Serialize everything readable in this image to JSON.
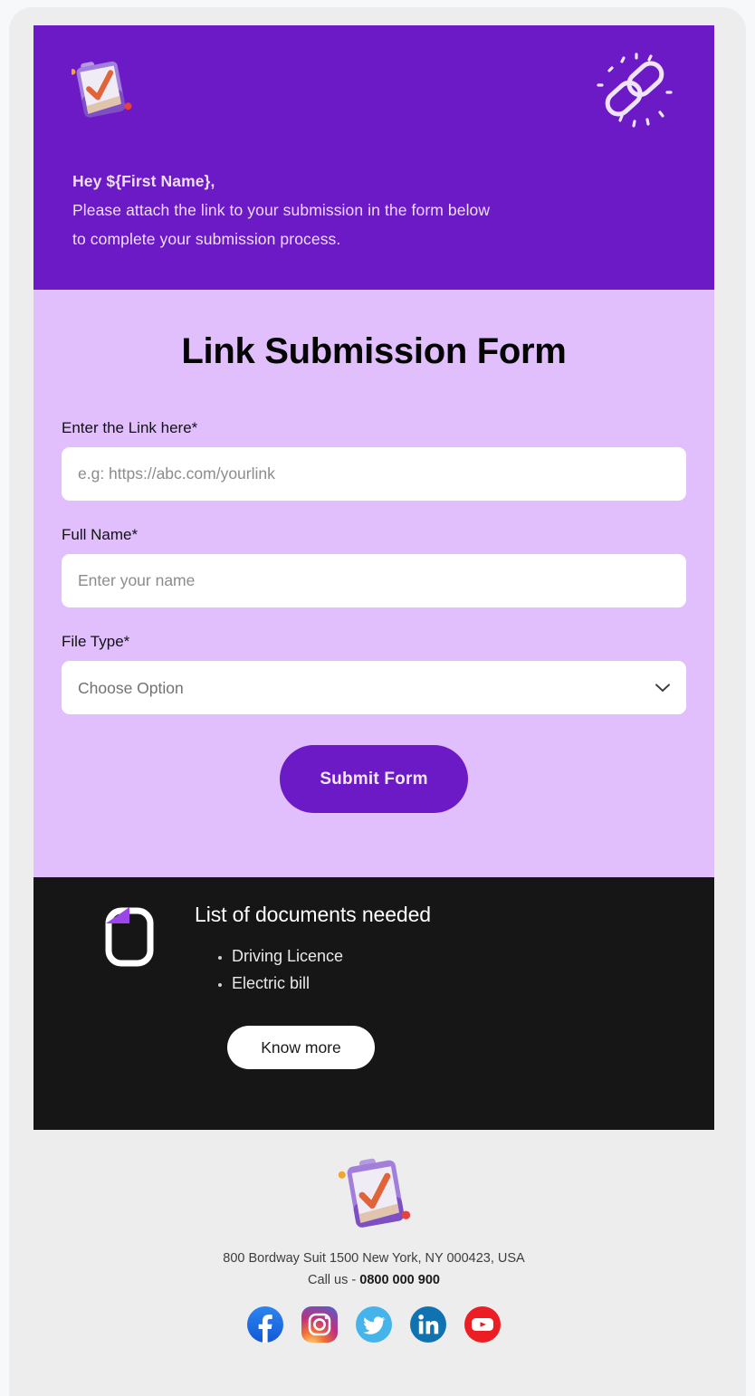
{
  "hero": {
    "clipboard_icon": "clipboard-check-3d-icon",
    "chain_icon": "chain-link-icon",
    "greeting": "Hey ${First Name},",
    "line_1": "Please attach the link to your submission in the form below",
    "line_2": "to complete your submission process.",
    "background_color": "#6C19C6",
    "text_color": "#EDDFF7"
  },
  "form": {
    "title": "Link Submission Form",
    "background_color": "#E0BFFC",
    "link_field": {
      "label": "Enter the Link here*",
      "placeholder": "e.g: https://abc.com/yourlink",
      "value": ""
    },
    "name_field": {
      "label": "Full Name*",
      "placeholder": "Enter your name",
      "value": ""
    },
    "filetype_field": {
      "label": "File Type*",
      "selected": "Choose Option",
      "chevron_icon": "chevron-down-icon"
    },
    "submit_label": "Submit Form",
    "submit_color": "#6C19C6"
  },
  "documents": {
    "background_color": "#161616",
    "file_icon": "document-file-icon",
    "heading": "List of documents needed",
    "items": [
      "Driving Licence",
      "Electric bill"
    ],
    "know_more_label": "Know more"
  },
  "footer": {
    "clipboard_icon": "clipboard-check-3d-icon",
    "address": "800 Bordway Suit 1500 New York, NY 000423, USA",
    "call_us_prefix": "Call us - ",
    "phone": "0800 000 900",
    "social": [
      {
        "name": "facebook-icon",
        "color": "#1877F2"
      },
      {
        "name": "instagram-icon",
        "color": "#E1306C"
      },
      {
        "name": "twitter-icon",
        "color": "#1DA1F2"
      },
      {
        "name": "linkedin-icon",
        "color": "#0A66C2"
      },
      {
        "name": "youtube-icon",
        "color": "#FF0000"
      }
    ]
  }
}
